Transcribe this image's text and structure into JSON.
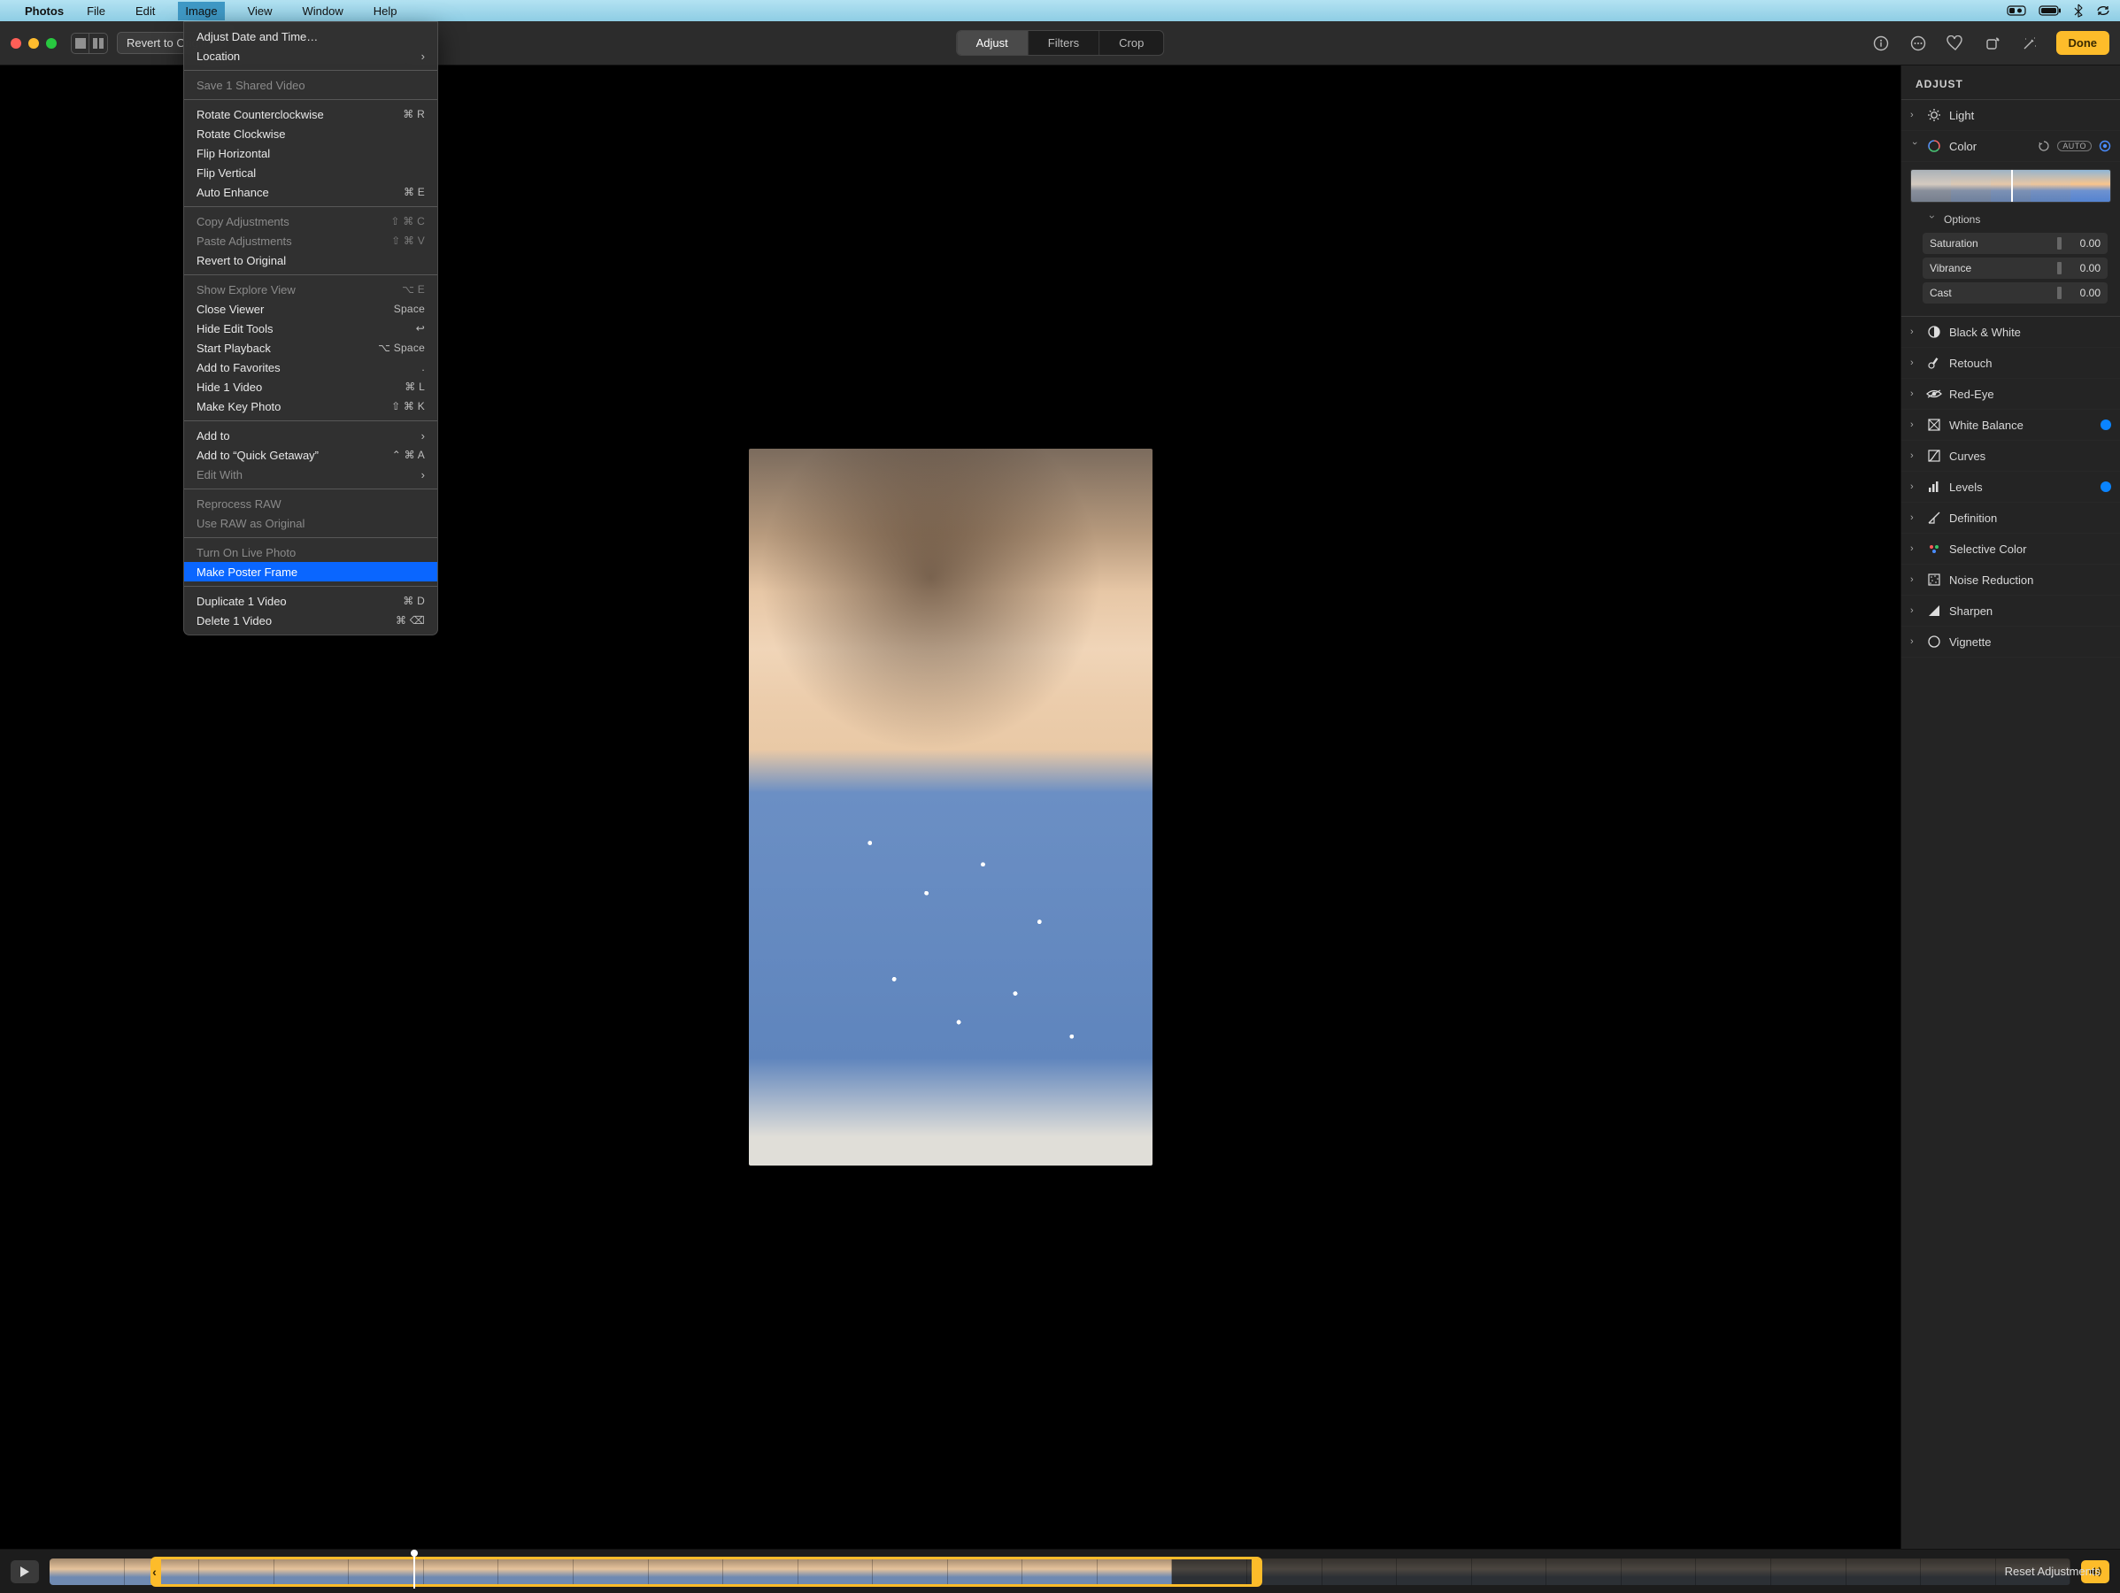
{
  "menubar": {
    "app": "Photos",
    "items": [
      "File",
      "Edit",
      "Image",
      "View",
      "Window",
      "Help"
    ],
    "open_index": 2
  },
  "toolbar": {
    "revert_label": "Revert to Original",
    "tabs": {
      "adjust": "Adjust",
      "filters": "Filters",
      "crop": "Crop",
      "active": "adjust"
    },
    "done_label": "Done"
  },
  "sidebar": {
    "title": "ADJUST",
    "rows": [
      {
        "id": "light",
        "label": "Light",
        "expanded": false
      },
      {
        "id": "color",
        "label": "Color",
        "expanded": true,
        "auto_label": "AUTO",
        "options_label": "Options",
        "sliders": [
          {
            "name": "Saturation",
            "value": "0.00"
          },
          {
            "name": "Vibrance",
            "value": "0.00"
          },
          {
            "name": "Cast",
            "value": "0.00"
          }
        ]
      },
      {
        "id": "bw",
        "label": "Black & White"
      },
      {
        "id": "retouch",
        "label": "Retouch"
      },
      {
        "id": "redeye",
        "label": "Red-Eye"
      },
      {
        "id": "wb",
        "label": "White Balance",
        "dot": true
      },
      {
        "id": "curves",
        "label": "Curves"
      },
      {
        "id": "levels",
        "label": "Levels",
        "dot": true
      },
      {
        "id": "definition",
        "label": "Definition"
      },
      {
        "id": "selcolor",
        "label": "Selective Color"
      },
      {
        "id": "noise",
        "label": "Noise Reduction"
      },
      {
        "id": "sharpen",
        "label": "Sharpen"
      },
      {
        "id": "vignette",
        "label": "Vignette"
      }
    ],
    "reset_label": "Reset Adjustments"
  },
  "dropdown": [
    {
      "label": "Adjust Date and Time…"
    },
    {
      "label": "Location",
      "submenu": true
    },
    {
      "sep": true
    },
    {
      "label": "Save 1 Shared Video",
      "disabled": true
    },
    {
      "sep": true
    },
    {
      "label": "Rotate Counterclockwise",
      "shortcut": "⌘ R"
    },
    {
      "label": "Rotate Clockwise"
    },
    {
      "label": "Flip Horizontal"
    },
    {
      "label": "Flip Vertical"
    },
    {
      "label": "Auto Enhance",
      "shortcut": "⌘ E"
    },
    {
      "sep": true
    },
    {
      "label": "Copy Adjustments",
      "shortcut": "⇧ ⌘ C",
      "disabled": true
    },
    {
      "label": "Paste Adjustments",
      "shortcut": "⇧ ⌘ V",
      "disabled": true
    },
    {
      "label": "Revert to Original"
    },
    {
      "sep": true
    },
    {
      "label": "Show Explore View",
      "shortcut": "⌥ E",
      "disabled": true
    },
    {
      "label": "Close Viewer",
      "shortcut": "Space"
    },
    {
      "label": "Hide Edit Tools",
      "shortcut": "↩"
    },
    {
      "label": "Start Playback",
      "shortcut": "⌥ Space"
    },
    {
      "label": "Add to Favorites",
      "shortcut": "."
    },
    {
      "label": "Hide 1 Video",
      "shortcut": "⌘ L"
    },
    {
      "label": "Make Key Photo",
      "shortcut": "⇧ ⌘ K"
    },
    {
      "sep": true
    },
    {
      "label": "Add to",
      "submenu": true
    },
    {
      "label": "Add to “Quick Getaway”",
      "shortcut": "⌃ ⌘ A"
    },
    {
      "label": "Edit With",
      "submenu": true,
      "disabled": true
    },
    {
      "sep": true
    },
    {
      "label": "Reprocess RAW",
      "disabled": true
    },
    {
      "label": "Use RAW as Original",
      "disabled": true
    },
    {
      "sep": true
    },
    {
      "label": "Turn On Live Photo",
      "disabled": true
    },
    {
      "label": "Make Poster Frame",
      "highlight": true
    },
    {
      "sep": true
    },
    {
      "label": "Duplicate 1 Video",
      "shortcut": "⌘ D"
    },
    {
      "label": "Delete 1 Video",
      "shortcut": "⌘ ⌫"
    }
  ]
}
